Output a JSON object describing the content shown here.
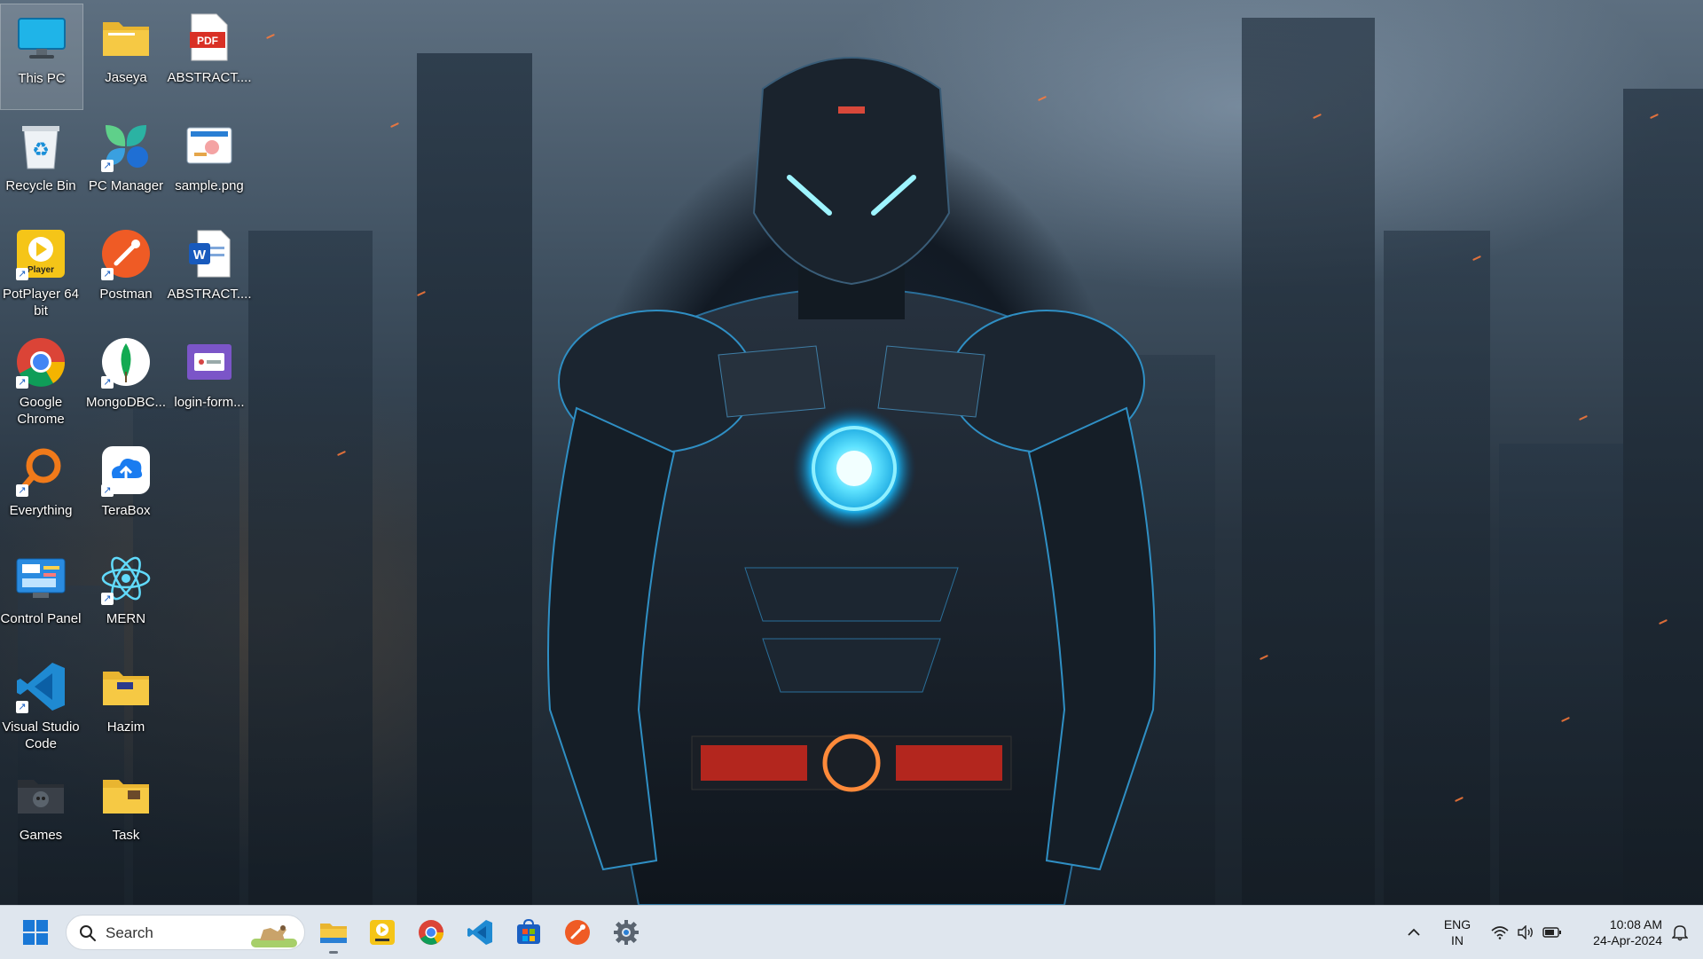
{
  "desktop": {
    "icons": [
      {
        "label": "This PC",
        "icon": "monitor-icon"
      },
      {
        "label": "Jaseya",
        "icon": "folder-icon"
      },
      {
        "label": "ABSTRACT....",
        "icon": "pdf-icon"
      },
      {
        "label": "Recycle Bin",
        "icon": "recycle-bin-icon"
      },
      {
        "label": "PC Manager",
        "icon": "pc-manager-icon"
      },
      {
        "label": "sample.png",
        "icon": "image-file-icon"
      },
      {
        "label": "PotPlayer 64 bit",
        "icon": "potplayer-icon",
        "badge": "Player"
      },
      {
        "label": "Postman",
        "icon": "postman-icon"
      },
      {
        "label": "ABSTRACT....",
        "icon": "word-doc-icon",
        "badge": "W"
      },
      {
        "label": "Google Chrome",
        "icon": "chrome-icon"
      },
      {
        "label": "MongoDBC...",
        "icon": "mongodb-icon"
      },
      {
        "label": "login-form...",
        "icon": "login-form-icon"
      },
      {
        "label": "Everything",
        "icon": "everything-search-icon"
      },
      {
        "label": "TeraBox",
        "icon": "terabox-icon"
      },
      {
        "label": "Control Panel",
        "icon": "control-panel-icon"
      },
      {
        "label": "MERN",
        "icon": "react-icon"
      },
      {
        "label": "Visual Studio Code",
        "icon": "vscode-icon"
      },
      {
        "label": "Hazim",
        "icon": "folder-icon"
      },
      {
        "label": "Games",
        "icon": "games-folder-icon"
      },
      {
        "label": "Task",
        "icon": "folder-icon"
      }
    ],
    "pdf_badge": "PDF"
  },
  "taskbar": {
    "start_icon": "windows-start-icon",
    "search_placeholder": "Search",
    "pinned": [
      {
        "name": "file-explorer-icon"
      },
      {
        "name": "potplayer-icon"
      },
      {
        "name": "chrome-icon"
      },
      {
        "name": "vscode-icon"
      },
      {
        "name": "microsoft-store-icon"
      },
      {
        "name": "postman-icon"
      },
      {
        "name": "settings-icon"
      }
    ],
    "tray": {
      "lang_top": "ENG",
      "lang_bottom": "IN",
      "time": "10:08 AM",
      "date": "24-Apr-2024"
    }
  },
  "colors": {
    "taskbar_bg": "#dfe6ee",
    "folder_yellow": "#f6c944",
    "accent_blue": "#1a6fd4"
  }
}
